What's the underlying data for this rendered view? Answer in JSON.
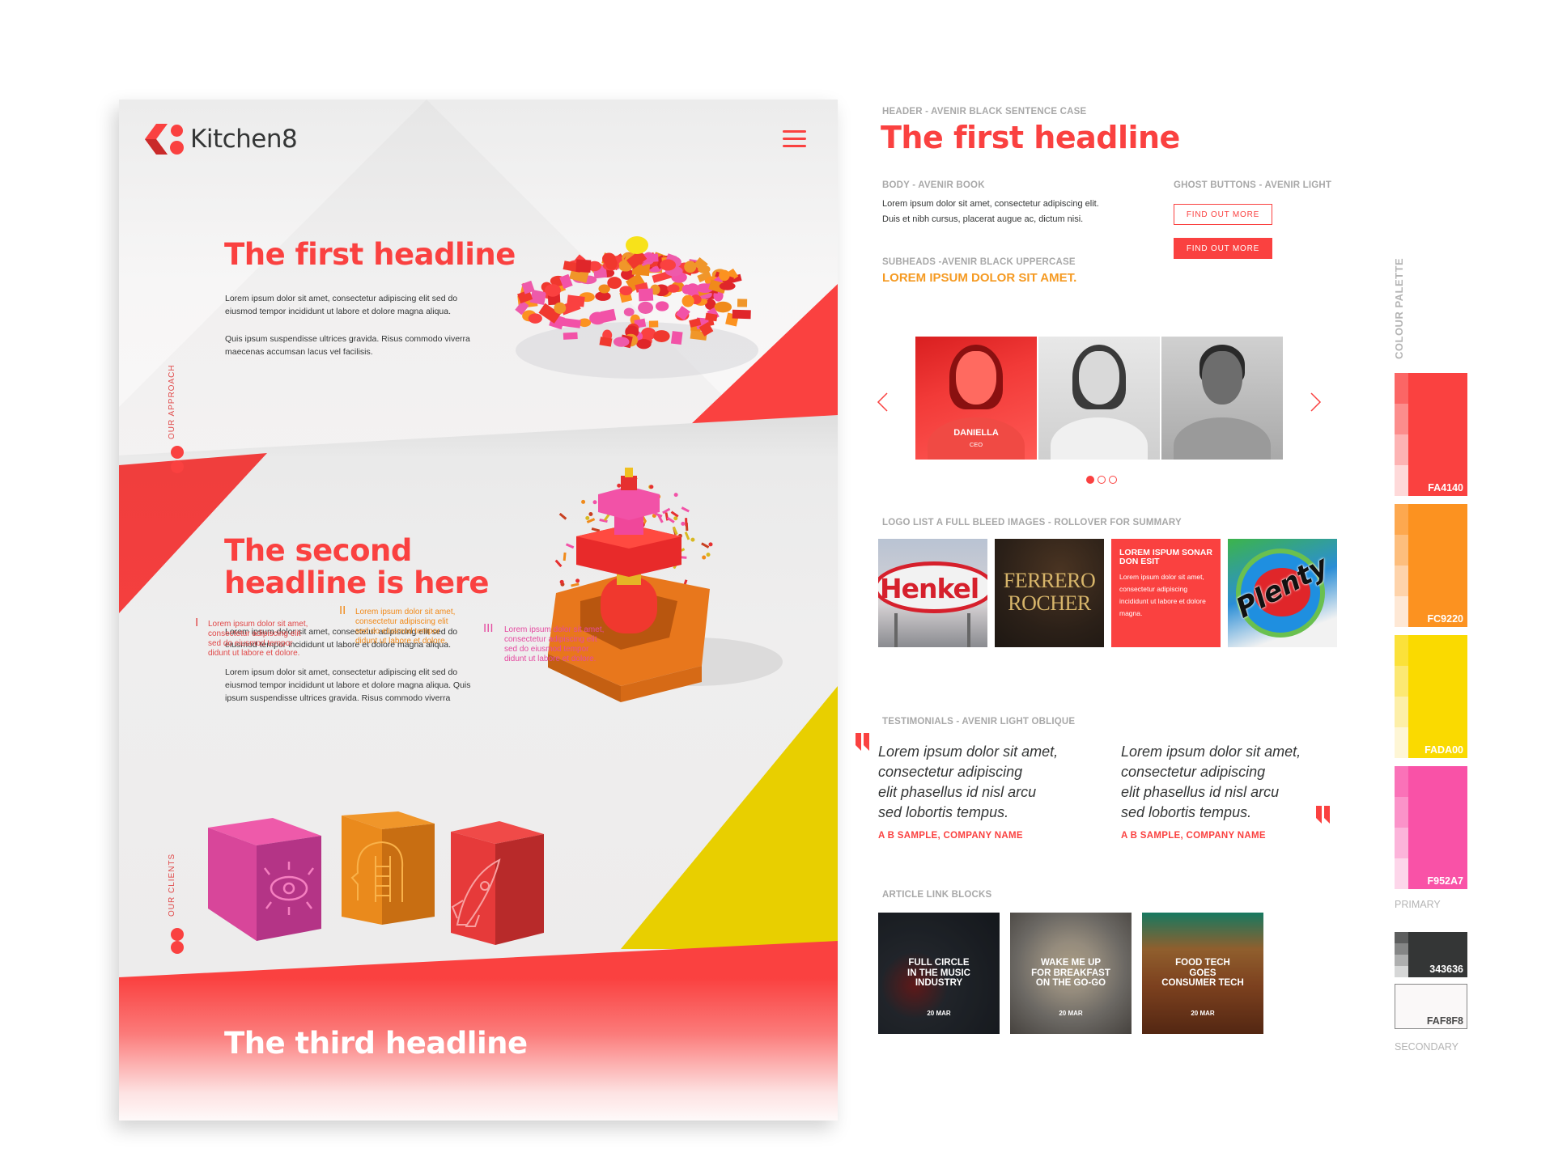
{
  "mockup": {
    "brand": "Kitchen8",
    "menu_icon": "hamburger-menu-icon",
    "section1": {
      "headline": "The first headline",
      "paragraphs": [
        "Lorem ipsum dolor sit amet, consectetur adipiscing elit sed do eiusmod tempor incididunt ut labore et dolore magna aliqua.",
        "Quis ipsum suspendisse ultrices gravida. Risus commodo viverra maecenas accumsan lacus vel facilisis."
      ]
    },
    "side_labels": [
      "OUR APPROACH",
      "OUR CLIENTS"
    ],
    "section2": {
      "headline_line1": "The second",
      "headline_line2": "headline is here",
      "paragraphs": [
        "Lorem ipsum dolor sit amet, consectetur adipiscing elit sed do eiusmod tempor incididunt ut labore et dolore magna aliqua.",
        "Lorem ipsum dolor sit amet, consectetur adipiscing elit sed do eiusmod tempor incididunt ut labore et dolore magna aliqua. Quis ipsum suspendisse ultrices gravida. Risus commodo viverra"
      ]
    },
    "features": [
      {
        "marker": "I",
        "text": "Lorem ipsum dolor sit amet, consectetur adipiscing elit sed do eiusmod tempor didunt ut labore et dolore.",
        "color": "#e04848",
        "icon": "eye-icon"
      },
      {
        "marker": "II",
        "text": "Lorem ipsum dolor sit amet, consectetur adipiscing elit sed do eiusmod tempor didunt ut labore et dolore.",
        "color": "#f08a1a",
        "icon": "head-ladder-icon"
      },
      {
        "marker": "III",
        "text": "Lorem ipsum dolor sit amet, consectetur adipiscing elit sed do eiusmod tempor didunt ut labore et dolore.",
        "color": "#e54aa0",
        "icon": "rocket-icon"
      }
    ],
    "section3": {
      "headline": "The third headline"
    }
  },
  "styleguide": {
    "header_label": "HEADER - AVENIR BLACK SENTENCE CASE",
    "header_sample": "The first headline",
    "body_label": "BODY - AVENIR BOOK",
    "body_lines": [
      "Lorem ipsum dolor sit amet, consectetur adipiscing elit.",
      "Duis et nibh cursus, placerat augue ac, dictum nisi."
    ],
    "subheads_label": "SUBHEADS -AVENIR BLACK UPPERCASE",
    "subheads_sample": "LOREM IPSUM DOLOR SIT AMET.",
    "ghost_label": "GHOST BUTTONS - AVENIR LIGHT",
    "ghost_button": "FIND OUT MORE",
    "solid_button": "FIND OUT MORE",
    "carousel": {
      "people": [
        {
          "name": "DANIELLA",
          "role": "CEO"
        },
        {
          "name": "",
          "role": ""
        },
        {
          "name": "",
          "role": ""
        }
      ],
      "active_index": 0,
      "dot_count": 3
    },
    "logo_label": "LOGO LIST A FULL BLEED IMAGES - ROLLOVER FOR SUMMARY",
    "logos": {
      "henkel": "Henkel",
      "ferrero_line1": "FERRERO",
      "ferrero_line2": "ROCHER",
      "summary_title": "LOREM ISPUM SONAR DON ESIT",
      "summary_body": "Lorem ipsum dolor sit amet, consectetur adipiscing incididunt ut labore et dolore magna.",
      "plenty": "Plenty"
    },
    "testimonials_label": "TESTIMONIALS - AVENIR LIGHT OBLIQUE",
    "testimonials": [
      {
        "lines": [
          "Lorem ipsum dolor sit amet,",
          "consectetur adipiscing",
          "elit phasellus id nisl arcu",
          "sed lobortis tempus."
        ],
        "author": "A B SAMPLE, COMPANY NAME"
      },
      {
        "lines": [
          "Lorem ipsum dolor sit amet,",
          "consectetur adipiscing",
          "elit phasellus id nisl arcu",
          "sed lobortis tempus."
        ],
        "author": "A B SAMPLE, COMPANY NAME"
      }
    ],
    "articles_label": "ARTICLE LINK BLOCKS",
    "articles": [
      {
        "title": "FULL CIRCLE\nIN THE MUSIC\nINDUSTRY",
        "date": "20 MAR"
      },
      {
        "title": "WAKE ME UP\nFOR BREAKFAST\nON THE GO-GO",
        "date": "20 MAR"
      },
      {
        "title": "FOOD TECH\nGOES\nCONSUMER TECH",
        "date": "20 MAR"
      }
    ]
  },
  "palette": {
    "title": "COLOUR PALETTE",
    "primary_label": "PRIMARY",
    "secondary_label": "SECONDARY",
    "primary": [
      {
        "hex": "FA4140",
        "color": "#fa4140",
        "tints": [
          "#fb6665",
          "#fc8d8c",
          "#fdb3b3",
          "#fed9d9"
        ]
      },
      {
        "hex": "FC9220",
        "color": "#fc9220",
        "tints": [
          "#fda84f",
          "#fdbe7d",
          "#fed3aa",
          "#fee8d5"
        ]
      },
      {
        "hex": "FADA00",
        "color": "#fada00",
        "tints": [
          "#fbe13a",
          "#fce873",
          "#fdefa8",
          "#fef6d5"
        ]
      },
      {
        "hex": "F952A7",
        "color": "#f952a7",
        "tints": [
          "#fa72b8",
          "#fb93c9",
          "#fcb4da",
          "#fdd6ea"
        ]
      }
    ],
    "secondary": [
      {
        "hex": "343636",
        "color": "#343636",
        "tints": [
          "#5d5e5e",
          "#858686",
          "#aeafaf",
          "#d6d7d7"
        ]
      },
      {
        "hex": "FAF8F8",
        "color": "#faf8f8",
        "tints": []
      }
    ]
  }
}
